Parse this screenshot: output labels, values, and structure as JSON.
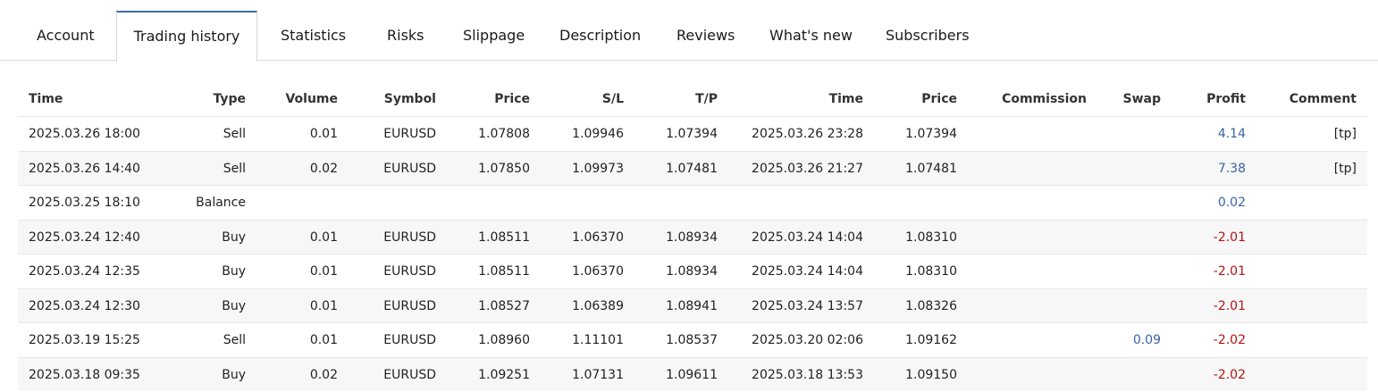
{
  "tabs": [
    {
      "label": "Account"
    },
    {
      "label": "Trading history",
      "active": true
    },
    {
      "label": "Statistics"
    },
    {
      "label": "Risks"
    },
    {
      "label": "Slippage"
    },
    {
      "label": "Description"
    },
    {
      "label": "Reviews"
    },
    {
      "label": "What's new"
    },
    {
      "label": "Subscribers"
    }
  ],
  "table": {
    "headers": {
      "time_open": "Time",
      "type": "Type",
      "volume": "Volume",
      "symbol": "Symbol",
      "price_open": "Price",
      "sl": "S/L",
      "tp": "T/P",
      "time_close": "Time",
      "price_close": "Price",
      "commission": "Commission",
      "swap": "Swap",
      "profit": "Profit",
      "comment": "Comment"
    },
    "rows": [
      {
        "time_open": "2025.03.26 18:00",
        "type": "Sell",
        "volume": "0.01",
        "symbol": "EURUSD",
        "price_open": "1.07808",
        "sl": "1.09946",
        "tp": "1.07394",
        "time_close": "2025.03.26 23:28",
        "price_close": "1.07394",
        "commission": "",
        "swap": "",
        "profit": "4.14",
        "comment": "[tp]"
      },
      {
        "time_open": "2025.03.26 14:40",
        "type": "Sell",
        "volume": "0.02",
        "symbol": "EURUSD",
        "price_open": "1.07850",
        "sl": "1.09973",
        "tp": "1.07481",
        "time_close": "2025.03.26 21:27",
        "price_close": "1.07481",
        "commission": "",
        "swap": "",
        "profit": "7.38",
        "comment": "[tp]"
      },
      {
        "time_open": "2025.03.25 18:10",
        "type": "Balance",
        "volume": "",
        "symbol": "",
        "price_open": "",
        "sl": "",
        "tp": "",
        "time_close": "",
        "price_close": "",
        "commission": "",
        "swap": "",
        "profit": "0.02",
        "comment": ""
      },
      {
        "time_open": "2025.03.24 12:40",
        "type": "Buy",
        "volume": "0.01",
        "symbol": "EURUSD",
        "price_open": "1.08511",
        "sl": "1.06370",
        "tp": "1.08934",
        "time_close": "2025.03.24 14:04",
        "price_close": "1.08310",
        "commission": "",
        "swap": "",
        "profit": "-2.01",
        "comment": ""
      },
      {
        "time_open": "2025.03.24 12:35",
        "type": "Buy",
        "volume": "0.01",
        "symbol": "EURUSD",
        "price_open": "1.08511",
        "sl": "1.06370",
        "tp": "1.08934",
        "time_close": "2025.03.24 14:04",
        "price_close": "1.08310",
        "commission": "",
        "swap": "",
        "profit": "-2.01",
        "comment": ""
      },
      {
        "time_open": "2025.03.24 12:30",
        "type": "Buy",
        "volume": "0.01",
        "symbol": "EURUSD",
        "price_open": "1.08527",
        "sl": "1.06389",
        "tp": "1.08941",
        "time_close": "2025.03.24 13:57",
        "price_close": "1.08326",
        "commission": "",
        "swap": "",
        "profit": "-2.01",
        "comment": ""
      },
      {
        "time_open": "2025.03.19 15:25",
        "type": "Sell",
        "volume": "0.01",
        "symbol": "EURUSD",
        "price_open": "1.08960",
        "sl": "1.11101",
        "tp": "1.08537",
        "time_close": "2025.03.20 02:06",
        "price_close": "1.09162",
        "commission": "",
        "swap": "0.09",
        "profit": "-2.02",
        "comment": ""
      },
      {
        "time_open": "2025.03.18 09:35",
        "type": "Buy",
        "volume": "0.02",
        "symbol": "EURUSD",
        "price_open": "1.09251",
        "sl": "1.07131",
        "tp": "1.09611",
        "time_close": "2025.03.18 13:53",
        "price_close": "1.09150",
        "commission": "",
        "swap": "",
        "profit": "-2.02",
        "comment": ""
      }
    ]
  },
  "colors": {
    "positive": "#3a64a6",
    "negative": "#b41313",
    "active_tab_accent": "#3f6fa8"
  }
}
